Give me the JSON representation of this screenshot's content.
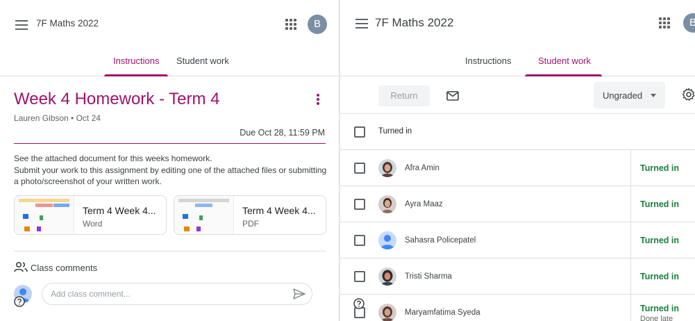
{
  "left": {
    "app_title": "7F Maths 2022",
    "avatar_letter": "B",
    "tabs": [
      {
        "label": "Instructions",
        "active": true
      },
      {
        "label": "Student work",
        "active": false
      }
    ],
    "assignment": {
      "title": "Week 4 Homework - Term 4",
      "meta": "Lauren Gibson • Oct 24",
      "due": "Due Oct 28, 11:59 PM",
      "description": "See the attached document for this weeks homework.\nSubmit your work to this assignment by editing one of the attached files or submitting a photo/screenshot of your written work."
    },
    "attachments": [
      {
        "name": "Term 4 Week 4...",
        "type": "Word"
      },
      {
        "name": "Term 4 Week 4...",
        "type": "PDF"
      }
    ],
    "comments": {
      "title": "Class comments",
      "placeholder": "Add class comment..."
    }
  },
  "right": {
    "app_title": "7F Maths 2022",
    "avatar_letter": "B",
    "tabs": [
      {
        "label": "Instructions",
        "active": false
      },
      {
        "label": "Student work",
        "active": true
      }
    ],
    "toolbar": {
      "return_label": "Return",
      "grade_filter": "Ungraded"
    },
    "list_header": "Turned in",
    "students": [
      {
        "name": "Afra Amin",
        "status": "Turned in",
        "sub": ""
      },
      {
        "name": "Ayra Maaz",
        "status": "Turned in",
        "sub": ""
      },
      {
        "name": "Sahasra Policepatel",
        "status": "Turned in",
        "sub": ""
      },
      {
        "name": "Tristi Sharma",
        "status": "Turned in",
        "sub": ""
      },
      {
        "name": "Maryamfatima Syeda",
        "status": "Turned in",
        "sub": "Done late"
      }
    ]
  },
  "colors": {
    "accent": "#a0136b",
    "turned_in": "#188038",
    "avatar_bg": "#7b8ea3"
  },
  "icons": {
    "menu": "hamburger-icon",
    "apps": "apps-grid-icon",
    "more": "kebab-icon",
    "mail": "mail-icon",
    "settings": "gear-icon",
    "comments": "people-icon",
    "send": "send-icon",
    "help": "help-icon"
  }
}
